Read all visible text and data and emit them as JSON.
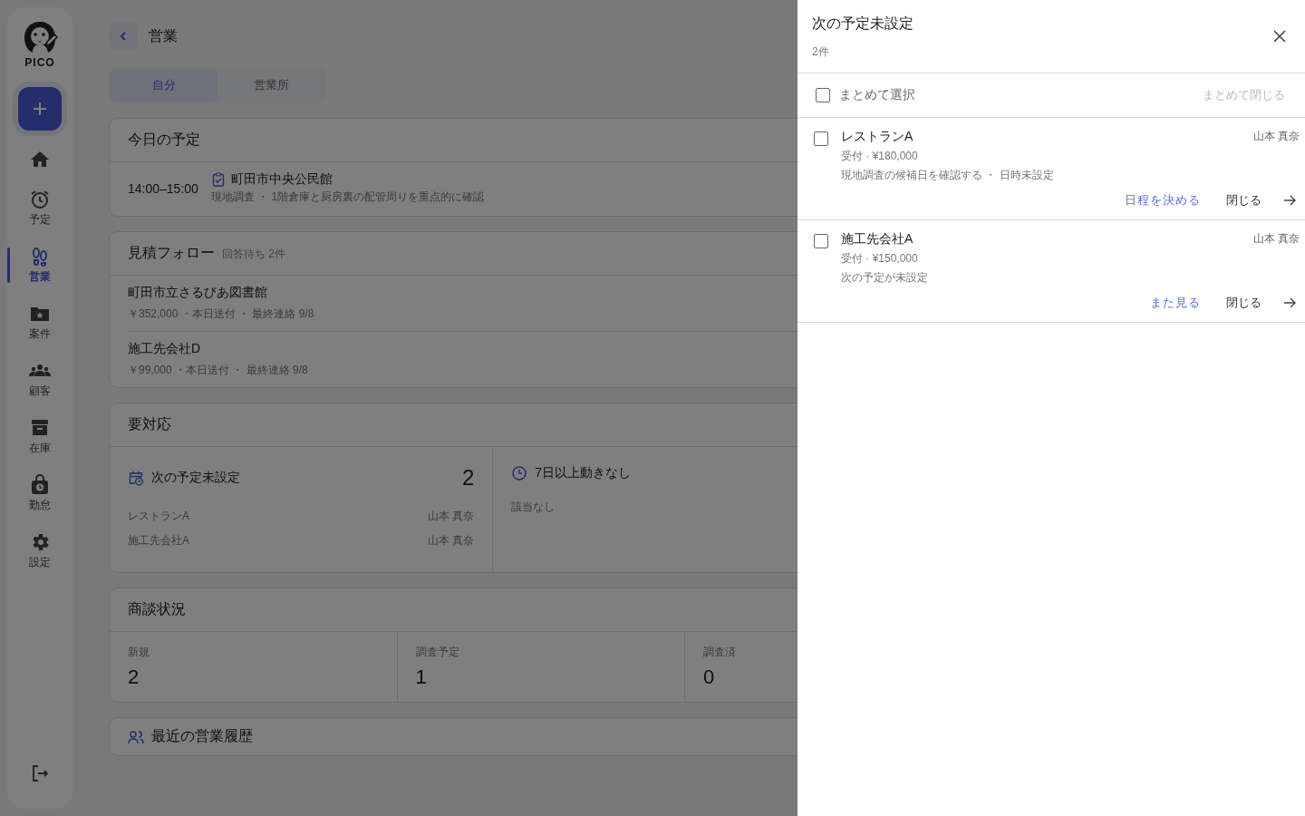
{
  "logo": {
    "text": "PICO"
  },
  "sidebar": {
    "items": [
      {
        "selected": false
      },
      {
        "label": "予定",
        "selected": false
      },
      {
        "label": "営業",
        "selected": true
      },
      {
        "label": "案件",
        "selected": false
      },
      {
        "label": "顧客",
        "selected": false
      },
      {
        "label": "在庫",
        "selected": false
      },
      {
        "label": "勤怠",
        "selected": false
      },
      {
        "label": "設定",
        "selected": false
      }
    ]
  },
  "header": {
    "title": "営業"
  },
  "tabs": [
    {
      "label": "自分",
      "selected": true
    },
    {
      "label": "営業所",
      "selected": false
    }
  ],
  "today": {
    "title": "今日の予定",
    "events": [
      {
        "time": "14:00–15:00",
        "place": "町田市中央公民館",
        "detail": "現地調査 ・ 1階倉庫と厨房裏の配管周りを重点的に確認"
      }
    ]
  },
  "quotes": {
    "title": "見積フォロー",
    "subtitle": "回答待ち 2件",
    "rows": [
      {
        "name": "町田市立さるびあ図書館",
        "detail": "￥352,000 ・本日送付 ・ 最終連絡 9/8"
      },
      {
        "name": "施工先会社D",
        "detail": "￥99,000 ・本日送付 ・ 最終連絡 9/8"
      }
    ]
  },
  "action_needed": {
    "title": "要対応",
    "columns": [
      {
        "title": "次の予定未設定",
        "count": "2",
        "rows": [
          {
            "name": "レストランA",
            "owner": "山本 真奈"
          },
          {
            "name": "施工先会社A",
            "owner": "山本 真奈"
          }
        ]
      },
      {
        "title": "7日以上動きなし",
        "empty": "該当なし"
      }
    ]
  },
  "deals": {
    "title": "商談状況",
    "stats": [
      {
        "label": "新規",
        "value": "2"
      },
      {
        "label": "調査予定",
        "value": "1"
      },
      {
        "label": "調査済",
        "value": "0"
      }
    ]
  },
  "history": {
    "title": "最近の営業履歴"
  },
  "drawer": {
    "title": "次の予定未設定",
    "count": "2件",
    "select_all": {
      "label": "まとめて選択",
      "checked": false
    },
    "bulk_close": {
      "label": "まとめて閉じる",
      "disabled": true
    },
    "items": [
      {
        "checked": false,
        "name": "レストランA",
        "owner": "山本 真奈",
        "status": "受付 · ¥180,000",
        "note": "現地調査の候補日を確認する ・ 日時未設定",
        "action": "日程を決める",
        "close": "閉じる"
      },
      {
        "checked": false,
        "name": "施工先会社A",
        "owner": "山本 真奈",
        "status": "受付 · ¥150,000",
        "note": "次の予定が未設定",
        "action": "また見る",
        "close": "閉じる"
      }
    ]
  }
}
